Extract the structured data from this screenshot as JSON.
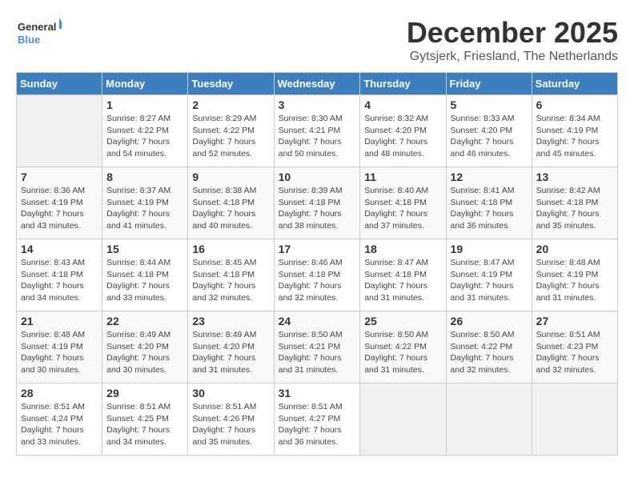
{
  "header": {
    "logo_line1": "General",
    "logo_line2": "Blue",
    "month": "December 2025",
    "location": "Gytsjerk, Friesland, The Netherlands"
  },
  "days_of_week": [
    "Sunday",
    "Monday",
    "Tuesday",
    "Wednesday",
    "Thursday",
    "Friday",
    "Saturday"
  ],
  "weeks": [
    [
      {
        "day": "",
        "info": ""
      },
      {
        "day": "1",
        "info": "Sunrise: 8:27 AM\nSunset: 4:22 PM\nDaylight: 7 hours\nand 54 minutes."
      },
      {
        "day": "2",
        "info": "Sunrise: 8:29 AM\nSunset: 4:22 PM\nDaylight: 7 hours\nand 52 minutes."
      },
      {
        "day": "3",
        "info": "Sunrise: 8:30 AM\nSunset: 4:21 PM\nDaylight: 7 hours\nand 50 minutes."
      },
      {
        "day": "4",
        "info": "Sunrise: 8:32 AM\nSunset: 4:20 PM\nDaylight: 7 hours\nand 48 minutes."
      },
      {
        "day": "5",
        "info": "Sunrise: 8:33 AM\nSunset: 4:20 PM\nDaylight: 7 hours\nand 46 minutes."
      },
      {
        "day": "6",
        "info": "Sunrise: 8:34 AM\nSunset: 4:19 PM\nDaylight: 7 hours\nand 45 minutes."
      }
    ],
    [
      {
        "day": "7",
        "info": "Sunrise: 8:36 AM\nSunset: 4:19 PM\nDaylight: 7 hours\nand 43 minutes."
      },
      {
        "day": "8",
        "info": "Sunrise: 8:37 AM\nSunset: 4:19 PM\nDaylight: 7 hours\nand 41 minutes."
      },
      {
        "day": "9",
        "info": "Sunrise: 8:38 AM\nSunset: 4:18 PM\nDaylight: 7 hours\nand 40 minutes."
      },
      {
        "day": "10",
        "info": "Sunrise: 8:39 AM\nSunset: 4:18 PM\nDaylight: 7 hours\nand 38 minutes."
      },
      {
        "day": "11",
        "info": "Sunrise: 8:40 AM\nSunset: 4:18 PM\nDaylight: 7 hours\nand 37 minutes."
      },
      {
        "day": "12",
        "info": "Sunrise: 8:41 AM\nSunset: 4:18 PM\nDaylight: 7 hours\nand 36 minutes."
      },
      {
        "day": "13",
        "info": "Sunrise: 8:42 AM\nSunset: 4:18 PM\nDaylight: 7 hours\nand 35 minutes."
      }
    ],
    [
      {
        "day": "14",
        "info": "Sunrise: 8:43 AM\nSunset: 4:18 PM\nDaylight: 7 hours\nand 34 minutes."
      },
      {
        "day": "15",
        "info": "Sunrise: 8:44 AM\nSunset: 4:18 PM\nDaylight: 7 hours\nand 33 minutes."
      },
      {
        "day": "16",
        "info": "Sunrise: 8:45 AM\nSunset: 4:18 PM\nDaylight: 7 hours\nand 32 minutes."
      },
      {
        "day": "17",
        "info": "Sunrise: 8:46 AM\nSunset: 4:18 PM\nDaylight: 7 hours\nand 32 minutes."
      },
      {
        "day": "18",
        "info": "Sunrise: 8:47 AM\nSunset: 4:18 PM\nDaylight: 7 hours\nand 31 minutes."
      },
      {
        "day": "19",
        "info": "Sunrise: 8:47 AM\nSunset: 4:19 PM\nDaylight: 7 hours\nand 31 minutes."
      },
      {
        "day": "20",
        "info": "Sunrise: 8:48 AM\nSunset: 4:19 PM\nDaylight: 7 hours\nand 31 minutes."
      }
    ],
    [
      {
        "day": "21",
        "info": "Sunrise: 8:48 AM\nSunset: 4:19 PM\nDaylight: 7 hours\nand 30 minutes."
      },
      {
        "day": "22",
        "info": "Sunrise: 8:49 AM\nSunset: 4:20 PM\nDaylight: 7 hours\nand 30 minutes."
      },
      {
        "day": "23",
        "info": "Sunrise: 8:49 AM\nSunset: 4:20 PM\nDaylight: 7 hours\nand 31 minutes."
      },
      {
        "day": "24",
        "info": "Sunrise: 8:50 AM\nSunset: 4:21 PM\nDaylight: 7 hours\nand 31 minutes."
      },
      {
        "day": "25",
        "info": "Sunrise: 8:50 AM\nSunset: 4:22 PM\nDaylight: 7 hours\nand 31 minutes."
      },
      {
        "day": "26",
        "info": "Sunrise: 8:50 AM\nSunset: 4:22 PM\nDaylight: 7 hours\nand 32 minutes."
      },
      {
        "day": "27",
        "info": "Sunrise: 8:51 AM\nSunset: 4:23 PM\nDaylight: 7 hours\nand 32 minutes."
      }
    ],
    [
      {
        "day": "28",
        "info": "Sunrise: 8:51 AM\nSunset: 4:24 PM\nDaylight: 7 hours\nand 33 minutes."
      },
      {
        "day": "29",
        "info": "Sunrise: 8:51 AM\nSunset: 4:25 PM\nDaylight: 7 hours\nand 34 minutes."
      },
      {
        "day": "30",
        "info": "Sunrise: 8:51 AM\nSunset: 4:26 PM\nDaylight: 7 hours\nand 35 minutes."
      },
      {
        "day": "31",
        "info": "Sunrise: 8:51 AM\nSunset: 4:27 PM\nDaylight: 7 hours\nand 36 minutes."
      },
      {
        "day": "",
        "info": ""
      },
      {
        "day": "",
        "info": ""
      },
      {
        "day": "",
        "info": ""
      }
    ]
  ]
}
